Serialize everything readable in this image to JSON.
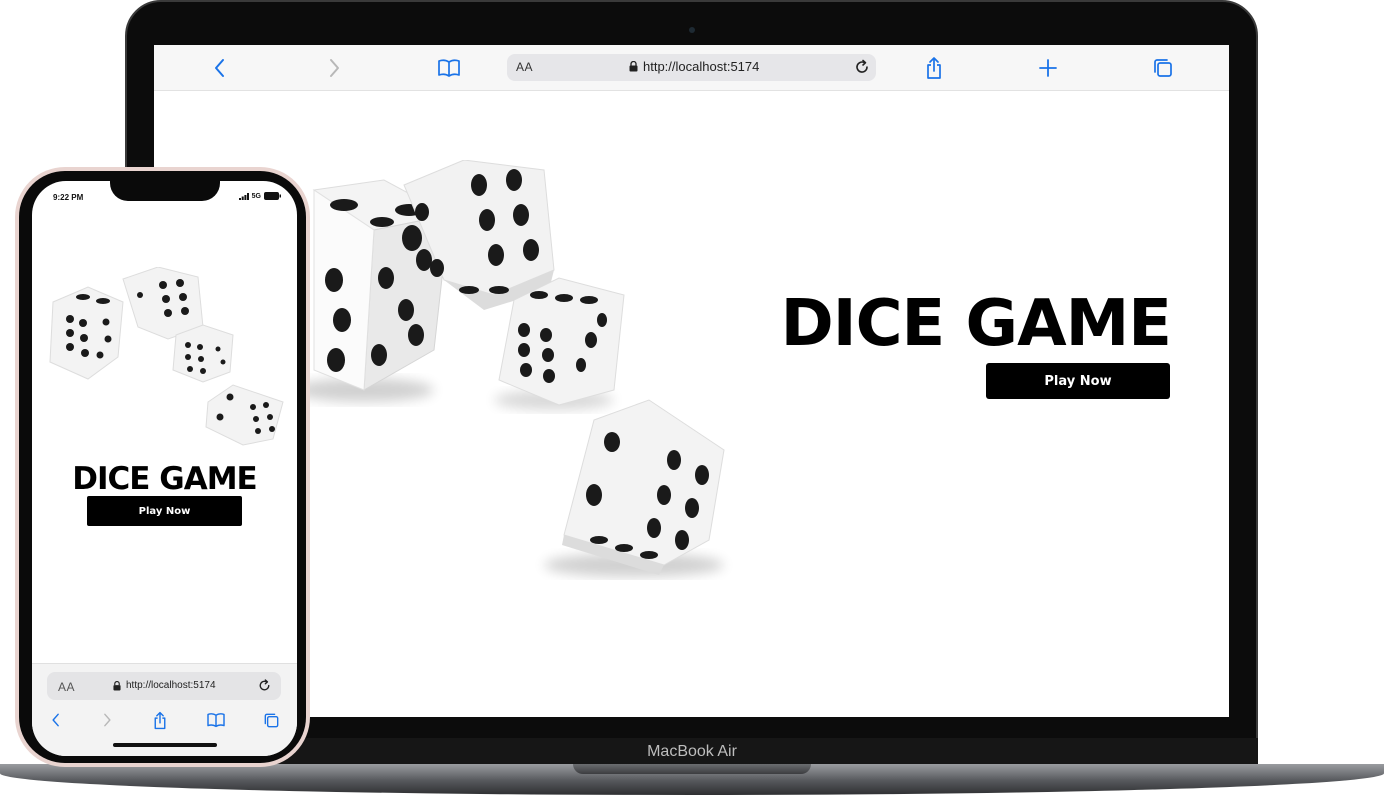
{
  "laptop": {
    "brand_label": "MacBook Air",
    "browser": {
      "aa_label": "AA",
      "url": "http://localhost:5174"
    },
    "page": {
      "title": "DICE GAME",
      "play_button": "Play Now"
    }
  },
  "phone": {
    "status": {
      "time": "9:22 PM",
      "network": "5G"
    },
    "page": {
      "title": "DICE GAME",
      "play_button": "Play Now"
    },
    "browser": {
      "aa_label": "AA",
      "url": "http://localhost:5174"
    }
  },
  "colors": {
    "ios_blue": "#1a73e8",
    "button_bg": "#000000",
    "dice_pip": "#1a1a1a"
  },
  "icons": [
    "back-chevron-icon",
    "forward-chevron-icon",
    "bookmarks-book-icon",
    "lock-icon",
    "reload-icon",
    "share-icon",
    "new-tab-plus-icon",
    "tabs-icon"
  ]
}
